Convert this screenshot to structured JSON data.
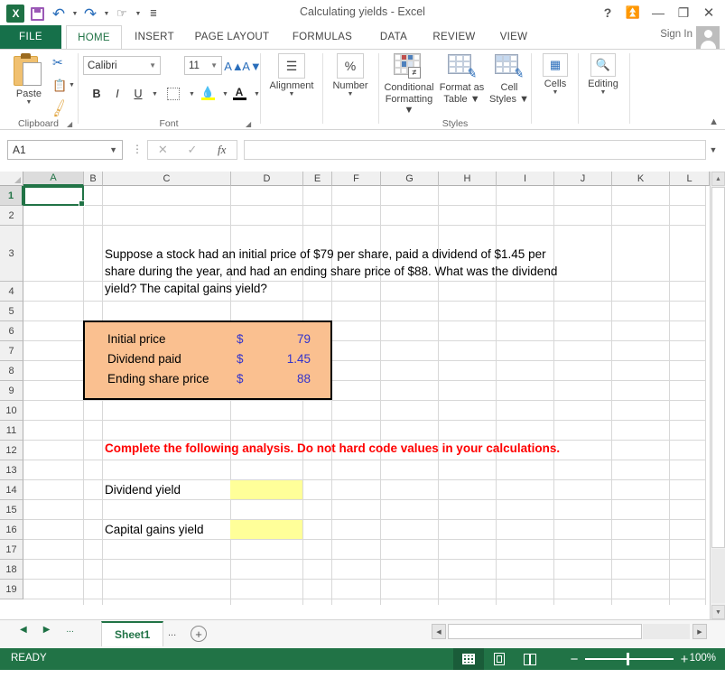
{
  "window": {
    "title": "Calculating yields - Excel",
    "help_icon": "?",
    "ribbon_display_icon": "ribbon-display-options",
    "minimize_icon": "minimize",
    "restore_icon": "restore",
    "close_icon": "close"
  },
  "quick_access": {
    "logo": "X",
    "save_label": "Save",
    "undo_label": "Undo",
    "redo_label": "Redo",
    "touch_label": "Touch/Mouse Mode",
    "customize_label": "Customize Quick Access Toolbar"
  },
  "ribbon": {
    "file_tab": "FILE",
    "tabs": [
      "HOME",
      "INSERT",
      "PAGE LAYOUT",
      "FORMULAS",
      "DATA",
      "REVIEW",
      "VIEW"
    ],
    "active_tab": "HOME",
    "sign_in": "Sign In",
    "groups": {
      "clipboard": {
        "label": "Clipboard",
        "paste": "Paste",
        "cut": "Cut",
        "copy": "Copy",
        "format_painter": "Format Painter"
      },
      "font": {
        "label": "Font",
        "font_name": "Calibri",
        "font_size": "11",
        "grow": "Increase Font Size",
        "shrink": "Decrease Font Size",
        "bold": "B",
        "italic": "I",
        "underline": "U",
        "borders": "Borders",
        "fill_color": "Fill Color",
        "font_color": "Font Color"
      },
      "alignment": {
        "label": "Alignment"
      },
      "number": {
        "label": "Number",
        "icon": "%"
      },
      "styles": {
        "label": "Styles",
        "conditional_formatting": "Conditional\nFormatting",
        "conditional_formatting_l1": "Conditional",
        "conditional_formatting_l2": "Formatting",
        "format_as_table_l1": "Format as",
        "format_as_table_l2": "Table",
        "cell_styles_l1": "Cell",
        "cell_styles_l2": "Styles"
      },
      "cells": {
        "label": "Cells"
      },
      "editing": {
        "label": "Editing"
      }
    },
    "collapse_label": "Collapse the Ribbon"
  },
  "formula_bar": {
    "name_box_value": "A1",
    "cancel_icon": "cancel",
    "enter_icon": "enter",
    "fx_icon": "fx",
    "formula_value": "",
    "expand_icon": "expand-formula-bar"
  },
  "grid": {
    "columns": [
      "A",
      "B",
      "C",
      "D",
      "E",
      "F",
      "G",
      "H",
      "I",
      "J",
      "K",
      "L"
    ],
    "rows": [
      "1",
      "2",
      "3",
      "4",
      "5",
      "6",
      "7",
      "8",
      "9",
      "10",
      "11",
      "12",
      "13",
      "14",
      "15",
      "16",
      "17",
      "18",
      "19"
    ],
    "selected_cell": "A1",
    "selected_column": "A",
    "selected_row": "1",
    "question_line1": "Suppose a stock had an initial price of $79 per share, paid a dividend of $1.45 per",
    "question_line2": "share during the year, and had an ending share price of $88. What was the dividend",
    "question_line3": "yield? The capital gains yield?",
    "input_box": {
      "rows": [
        {
          "label": "Initial price",
          "currency": "$",
          "value": "79"
        },
        {
          "label": "Dividend paid",
          "currency": "$",
          "value": "1.45"
        },
        {
          "label": "Ending share price",
          "currency": "$",
          "value": "88"
        }
      ],
      "fill_color": "#FAC090",
      "border_color": "#000000",
      "value_color": "#3333CC"
    },
    "instruction": "Complete the following analysis. Do not hard code values in your calculations.",
    "instruction_color": "#FF0000",
    "answers": [
      {
        "label": "Dividend yield",
        "value": ""
      },
      {
        "label": "Capital gains yield",
        "value": ""
      }
    ],
    "answer_fill": "#FFFF99"
  },
  "sheet_bar": {
    "first_label": "First Sheet",
    "prev_label": "Previous Sheet",
    "next_label": "Next Sheet",
    "last_label": "Last Sheet",
    "left_dots": "...",
    "right_dots": "...",
    "tabs": [
      "Sheet1"
    ],
    "active_tab": "Sheet1",
    "add_sheet": "+"
  },
  "status_bar": {
    "mode": "READY",
    "view_normal": "Normal",
    "view_page_layout": "Page Layout",
    "view_page_break": "Page Break Preview",
    "zoom_out": "−",
    "zoom_in": "+",
    "zoom_level": "100%"
  }
}
